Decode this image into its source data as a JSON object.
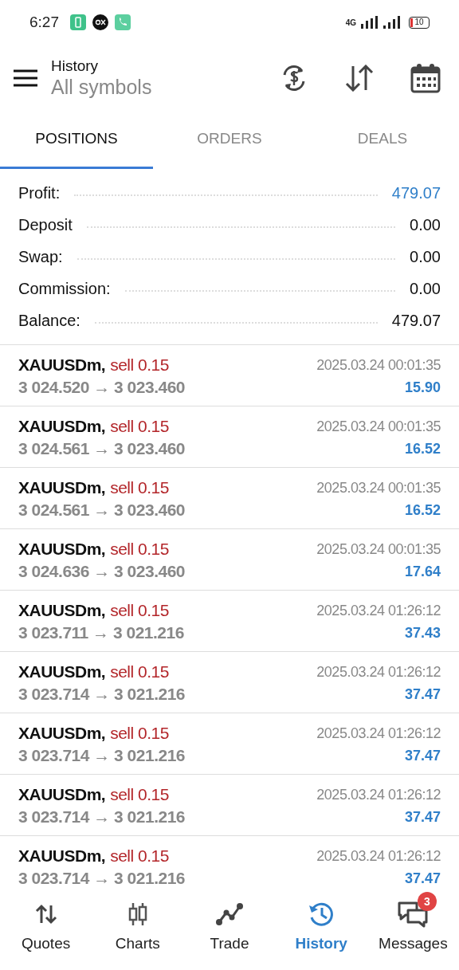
{
  "status_bar": {
    "time": "6:27",
    "network": "4G",
    "battery": "10"
  },
  "header": {
    "title": "History",
    "subtitle": "All symbols"
  },
  "tabs": [
    {
      "label": "POSITIONS",
      "selected": true
    },
    {
      "label": "ORDERS",
      "selected": false
    },
    {
      "label": "DEALS",
      "selected": false
    }
  ],
  "summary": [
    {
      "label": "Profit:",
      "value": "479.07",
      "highlight": true
    },
    {
      "label": "Deposit",
      "value": "0.00",
      "highlight": false
    },
    {
      "label": "Swap:",
      "value": "0.00",
      "highlight": false
    },
    {
      "label": "Commission:",
      "value": "0.00",
      "highlight": false
    },
    {
      "label": "Balance:",
      "value": "479.07",
      "highlight": false
    }
  ],
  "positions": [
    {
      "symbol": "XAUUSDm,",
      "type": "sell 0.15",
      "time": "2025.03.24 00:01:35",
      "prices": "3 024.520 → 3 023.460",
      "profit": "15.90"
    },
    {
      "symbol": "XAUUSDm,",
      "type": "sell 0.15",
      "time": "2025.03.24 00:01:35",
      "prices": "3 024.561 → 3 023.460",
      "profit": "16.52"
    },
    {
      "symbol": "XAUUSDm,",
      "type": "sell 0.15",
      "time": "2025.03.24 00:01:35",
      "prices": "3 024.561 → 3 023.460",
      "profit": "16.52"
    },
    {
      "symbol": "XAUUSDm,",
      "type": "sell 0.15",
      "time": "2025.03.24 00:01:35",
      "prices": "3 024.636 → 3 023.460",
      "profit": "17.64"
    },
    {
      "symbol": "XAUUSDm,",
      "type": "sell 0.15",
      "time": "2025.03.24 01:26:12",
      "prices": "3 023.711 → 3 021.216",
      "profit": "37.43"
    },
    {
      "symbol": "XAUUSDm,",
      "type": "sell 0.15",
      "time": "2025.03.24 01:26:12",
      "prices": "3 023.714 → 3 021.216",
      "profit": "37.47"
    },
    {
      "symbol": "XAUUSDm,",
      "type": "sell 0.15",
      "time": "2025.03.24 01:26:12",
      "prices": "3 023.714 → 3 021.216",
      "profit": "37.47"
    },
    {
      "symbol": "XAUUSDm,",
      "type": "sell 0.15",
      "time": "2025.03.24 01:26:12",
      "prices": "3 023.714 → 3 021.216",
      "profit": "37.47"
    },
    {
      "symbol": "XAUUSDm,",
      "type": "sell 0.15",
      "time": "2025.03.24 01:26:12",
      "prices": "3 023.714 → 3 021.216",
      "profit": "37.47"
    }
  ],
  "nav": [
    {
      "kind": "quotes",
      "label": "Quotes",
      "selected": false
    },
    {
      "kind": "charts",
      "label": "Charts",
      "selected": false
    },
    {
      "kind": "trade",
      "label": "Trade",
      "selected": false
    },
    {
      "kind": "history",
      "label": "History",
      "selected": true
    },
    {
      "kind": "messages",
      "label": "Messages",
      "selected": false,
      "badge": "3"
    }
  ]
}
